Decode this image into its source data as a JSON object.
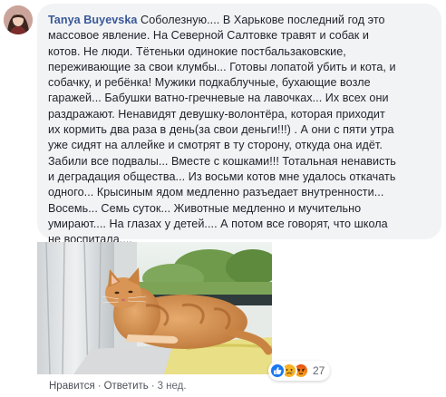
{
  "comment": {
    "author": "Tanya Buyevska",
    "text": "Соболезную.... В Харькове последний год это\nмассовое явление. На Северной Салтовке травят и собак и\nкотов. Не люди. Тётеньки одинокие постбальзаковские,\nпереживающие за свои клумбы... Готовы лопатой убить и кота, и\nсобачку, и ребёнка! Мужики подкаблучные, бухающие возле\nгаражей... Бабушки ватно-гречневые на лавочках... Их всех они\nраздражают. Ненавидят девушку-волонтёра, которая приходит\nих кормить два раза в день(за свои деньги!!!) . А они с пяти утра\nуже сидят на аллейке и смотрят в ту сторону, откуда она идёт.\nЗабили все подвалы... Вместе с кошками!!! Тотальная ненависть\nи деградация общества... Из восьми котов мне удалось откачать\nодного... Крысиным ядом медленно разъедает внутренности...\nВосемь... Семь суток... Животные медленно и мучительно\nумирают.... На глазах у детей.... А потом все говорят, что школа\nне воспитала...."
  },
  "reactions": {
    "icons": [
      "like-icon",
      "sad-icon",
      "angry-icon"
    ],
    "count": "27"
  },
  "actions": {
    "like": "Нравится",
    "reply": "Ответить",
    "time": "3 нед.",
    "separator": "·"
  },
  "colors": {
    "author": "#385898",
    "bubble": "#f2f3f5",
    "text": "#1d2129",
    "meta": "#606770",
    "like": "#1877f2",
    "sad": "#f7b125",
    "angry": "#e9710f"
  }
}
